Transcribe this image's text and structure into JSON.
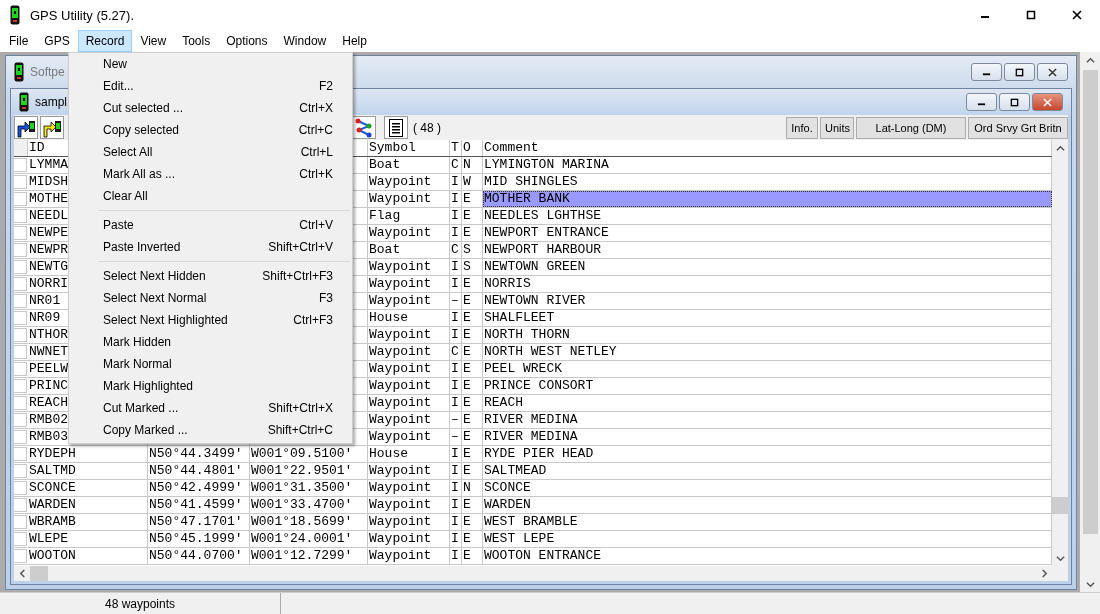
{
  "window": {
    "title": "GPS Utility (5.27)."
  },
  "menubar": [
    {
      "label": "File",
      "selected": false
    },
    {
      "label": "GPS",
      "selected": false
    },
    {
      "label": "Record",
      "selected": true
    },
    {
      "label": "View",
      "selected": false
    },
    {
      "label": "Tools",
      "selected": false
    },
    {
      "label": "Options",
      "selected": false
    },
    {
      "label": "Window",
      "selected": false
    },
    {
      "label": "Help",
      "selected": false
    }
  ],
  "record_menu": [
    {
      "kind": "item",
      "label": "New"
    },
    {
      "kind": "item",
      "label": "Edit...",
      "shortcut": "F2"
    },
    {
      "kind": "item",
      "label": "Cut selected ...",
      "shortcut": "Ctrl+X"
    },
    {
      "kind": "item",
      "label": "Copy selected",
      "shortcut": "Ctrl+C"
    },
    {
      "kind": "item",
      "label": "Select All",
      "shortcut": "Ctrl+L"
    },
    {
      "kind": "item",
      "label": "Mark All as ...",
      "shortcut": "Ctrl+K"
    },
    {
      "kind": "item",
      "label": "Clear All"
    },
    {
      "kind": "separator"
    },
    {
      "kind": "item",
      "label": "Paste",
      "shortcut": "Ctrl+V"
    },
    {
      "kind": "item",
      "label": "Paste Inverted",
      "shortcut": "Shift+Ctrl+V"
    },
    {
      "kind": "separator"
    },
    {
      "kind": "item",
      "label": "Select Next Hidden",
      "shortcut": "Shift+Ctrl+F3"
    },
    {
      "kind": "item",
      "label": "Select Next Normal",
      "shortcut": "F3"
    },
    {
      "kind": "item",
      "label": "Select Next Highlighted",
      "shortcut": "Ctrl+F3"
    },
    {
      "kind": "item",
      "label": "Mark Hidden"
    },
    {
      "kind": "item",
      "label": "Mark Normal"
    },
    {
      "kind": "item",
      "label": "Mark Highlighted"
    },
    {
      "kind": "item",
      "label": "Cut Marked ...",
      "shortcut": "Shift+Ctrl+X"
    },
    {
      "kind": "item",
      "label": "Copy Marked ...",
      "shortcut": "Shift+Ctrl+C"
    }
  ],
  "outer_child_window": {
    "title": "Softpe"
  },
  "child_window": {
    "title": "sampl",
    "toolbar": {
      "count": "( 48 )",
      "buttons": [
        "Info.",
        "Units",
        "Lat-Long (DM)",
        "Ord Srvy Grt Britn"
      ]
    },
    "table": {
      "columns": [
        "ID",
        "Symbol",
        "T",
        "O",
        "Comment"
      ],
      "rows": [
        {
          "id": "LYMMA",
          "symbol": "Boat",
          "t": "C",
          "o": "N",
          "comment": "LYMINGTON MARINA",
          "selected": false
        },
        {
          "id": "MIDSH",
          "symbol": "Waypoint",
          "t": "I",
          "o": "W",
          "comment": "MID SHINGLES",
          "selected": false
        },
        {
          "id": "MOTHE",
          "symbol": "Waypoint",
          "t": "I",
          "o": "E",
          "comment": "MOTHER BANK",
          "selected": true
        },
        {
          "id": "NEEDL",
          "symbol": "Flag",
          "t": "I",
          "o": "E",
          "comment": "NEEDLES LGHTHSE",
          "selected": false
        },
        {
          "id": "NEWPE",
          "symbol": "Waypoint",
          "t": "I",
          "o": "E",
          "comment": "NEWPORT ENTRANCE",
          "selected": false
        },
        {
          "id": "NEWPR",
          "symbol": "Boat",
          "t": "C",
          "o": "S",
          "comment": "NEWPORT HARBOUR",
          "selected": false
        },
        {
          "id": "NEWTG",
          "symbol": "Waypoint",
          "t": "I",
          "o": "S",
          "comment": "NEWTOWN GREEN",
          "selected": false
        },
        {
          "id": "NORRI",
          "symbol": "Waypoint",
          "t": "I",
          "o": "E",
          "comment": "NORRIS",
          "selected": false
        },
        {
          "id": "NR01",
          "symbol": "Waypoint",
          "t": "–",
          "o": "E",
          "comment": "NEWTOWN RIVER",
          "selected": false
        },
        {
          "id": "NR09",
          "symbol": "House",
          "t": "I",
          "o": "E",
          "comment": "SHALFLEET",
          "selected": false
        },
        {
          "id": "NTHOR",
          "symbol": "Waypoint",
          "t": "I",
          "o": "E",
          "comment": "NORTH THORN",
          "selected": false
        },
        {
          "id": "NWNET",
          "symbol": "Waypoint",
          "t": "C",
          "o": "E",
          "comment": "NORTH WEST NETLEY",
          "selected": false
        },
        {
          "id": "PEELW",
          "symbol": "Waypoint",
          "t": "I",
          "o": "E",
          "comment": "PEEL WRECK",
          "selected": false
        },
        {
          "id": "PRINC",
          "symbol": "Waypoint",
          "t": "I",
          "o": "E",
          "comment": "PRINCE CONSORT",
          "selected": false
        },
        {
          "id": "REACH",
          "symbol": "Waypoint",
          "t": "I",
          "o": "E",
          "comment": "REACH",
          "selected": false
        },
        {
          "id": "RMB02",
          "symbol": "Waypoint",
          "t": "–",
          "o": "E",
          "comment": "RIVER MEDINA",
          "selected": false
        },
        {
          "id": "RMB03",
          "symbol": "Waypoint",
          "t": "–",
          "o": "E",
          "comment": "RIVER MEDINA",
          "selected": false
        },
        {
          "id": "RYDEPH",
          "latitude": "N50°44.3499'",
          "longitude": "W001°09.5100'",
          "symbol": "House",
          "t": "I",
          "o": "E",
          "comment": "RYDE PIER HEAD",
          "selected": false
        },
        {
          "id": "SALTMD",
          "latitude": "N50°44.4801'",
          "longitude": "W001°22.9501'",
          "symbol": "Waypoint",
          "t": "I",
          "o": "E",
          "comment": "SALTMEAD",
          "selected": false
        },
        {
          "id": "SCONCE",
          "latitude": "N50°42.4999'",
          "longitude": "W001°31.3500'",
          "symbol": "Waypoint",
          "t": "I",
          "o": "N",
          "comment": "SCONCE",
          "selected": false
        },
        {
          "id": "WARDEN",
          "latitude": "N50°41.4599'",
          "longitude": "W001°33.4700'",
          "symbol": "Waypoint",
          "t": "I",
          "o": "E",
          "comment": "WARDEN",
          "selected": false
        },
        {
          "id": "WBRAMB",
          "latitude": "N50°47.1701'",
          "longitude": "W001°18.5699'",
          "symbol": "Waypoint",
          "t": "I",
          "o": "E",
          "comment": "WEST BRAMBLE",
          "selected": false
        },
        {
          "id": "WLEPE",
          "latitude": "N50°45.1999'",
          "longitude": "W001°24.0001'",
          "symbol": "Waypoint",
          "t": "I",
          "o": "E",
          "comment": "WEST LEPE",
          "selected": false
        },
        {
          "id": "WOOTON",
          "latitude": "N50°44.0700'",
          "longitude": "W001°12.7299'",
          "symbol": "Waypoint",
          "t": "I",
          "o": "E",
          "comment": "WOOTON ENTRANCE",
          "selected": false
        }
      ]
    }
  },
  "status_bar": {
    "panels": [
      "48 waypoints"
    ]
  }
}
